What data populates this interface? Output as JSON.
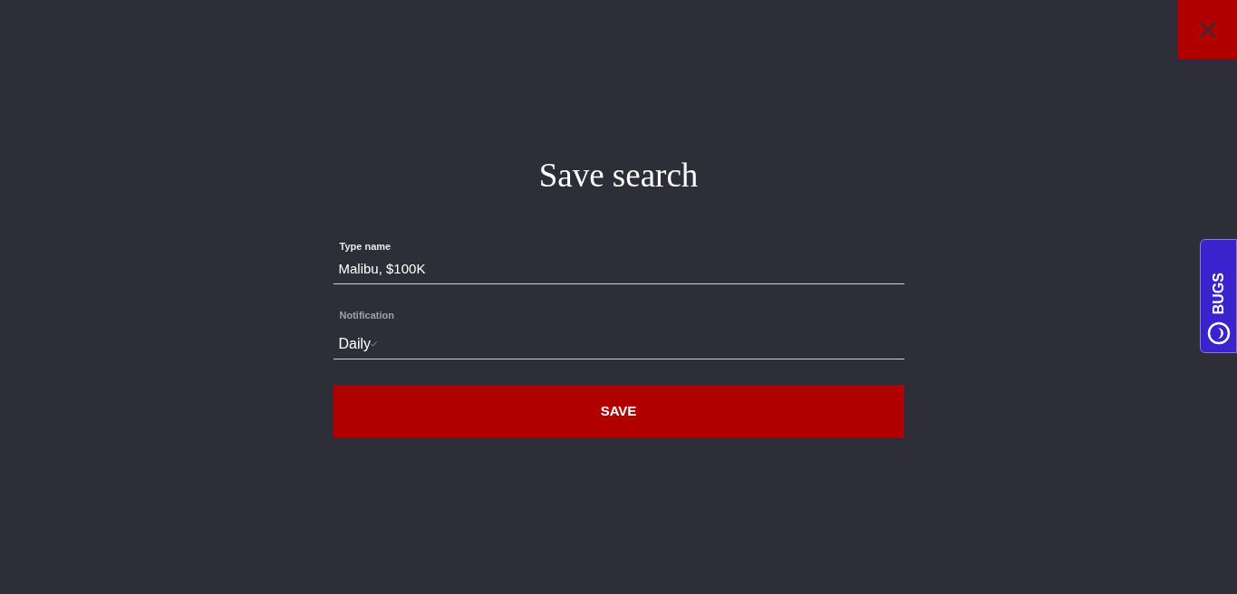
{
  "dialog": {
    "title": "Save search",
    "fields": [
      {
        "kind": "text",
        "label": "Type name",
        "value": "Malibu, $100K"
      },
      {
        "kind": "select",
        "label": "Notification",
        "value": "Daily"
      }
    ],
    "save_button": "SAVE"
  },
  "feedback_tab": {
    "label": "BUGS"
  }
}
